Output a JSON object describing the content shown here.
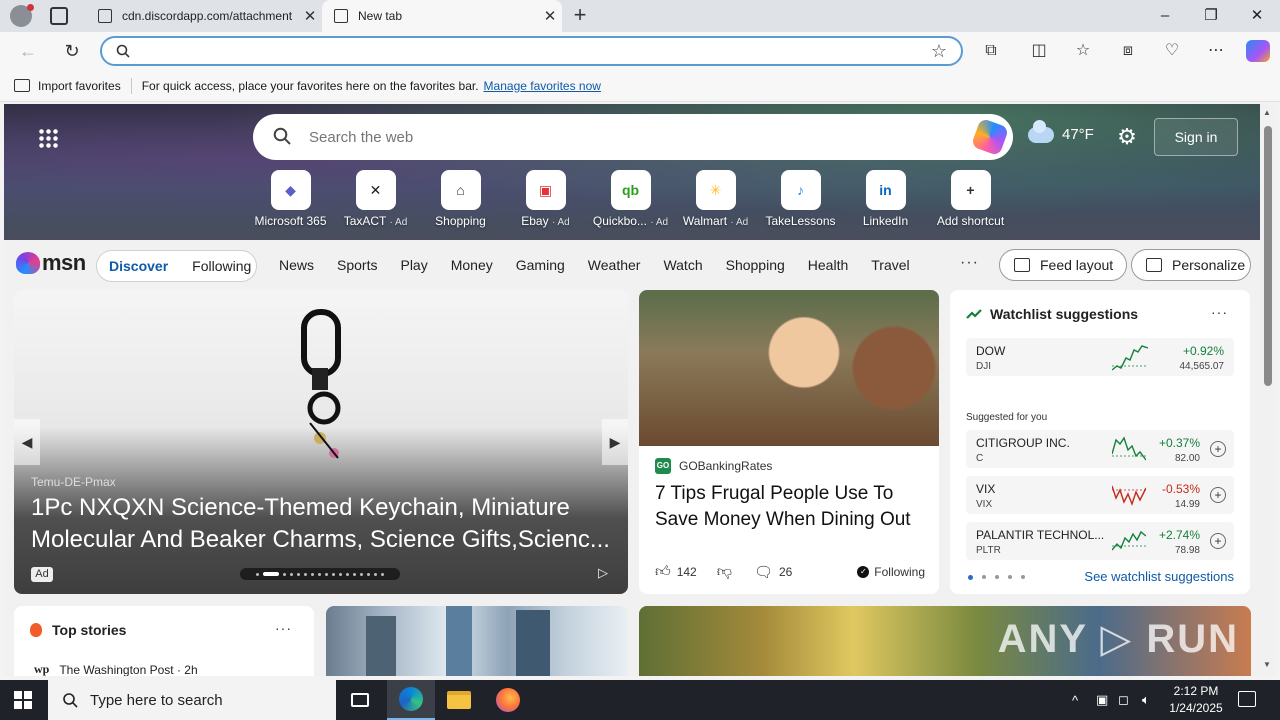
{
  "browser": {
    "tabs": [
      {
        "label": "cdn.discordapp.com/attachment",
        "active": false
      },
      {
        "label": "New tab",
        "active": true
      }
    ],
    "address": {
      "value": "",
      "placeholder": ""
    },
    "window_controls": {
      "minimize": "–",
      "restore": "❐",
      "close": "✕"
    },
    "favbar": {
      "import_label": "Import favorites",
      "hint": "For quick access, place your favorites here on the favorites bar.",
      "manage_link": "Manage favorites now"
    }
  },
  "hero": {
    "search_placeholder": "Search the web",
    "weather": "47°F",
    "signin": "Sign in",
    "shortcuts": [
      {
        "label": "Microsoft 365",
        "ad": "",
        "icon": "microsoft365-icon",
        "glyph": "◆",
        "color": "#5b5fc7"
      },
      {
        "label": "TaxACT",
        "ad": "· Ad",
        "icon": "taxact-icon",
        "glyph": "✕",
        "color": "#1b1f2a"
      },
      {
        "label": "Shopping",
        "ad": "",
        "icon": "shopping-tag-icon",
        "glyph": "⌂",
        "color": "#333333"
      },
      {
        "label": "Ebay",
        "ad": "· Ad",
        "icon": "ebay-icon",
        "glyph": "▣",
        "color": "#e53238"
      },
      {
        "label": "Quickbo...",
        "ad": "· Ad",
        "icon": "quickbooks-icon",
        "glyph": "qb",
        "color": "#2ca01c"
      },
      {
        "label": "Walmart",
        "ad": "· Ad",
        "icon": "walmart-icon",
        "glyph": "✳",
        "color": "#ffc220"
      },
      {
        "label": "TakeLessons",
        "ad": "",
        "icon": "takelessons-icon",
        "glyph": "♪",
        "color": "#2d89ef"
      },
      {
        "label": "LinkedIn",
        "ad": "",
        "icon": "linkedin-icon",
        "glyph": "in",
        "color": "#0a66c2"
      },
      {
        "label": "Add shortcut",
        "ad": "",
        "icon": "plus-icon",
        "glyph": "+",
        "color": "#333333"
      }
    ]
  },
  "msn": {
    "logo": "msn",
    "toggle": {
      "active": "Discover",
      "other": "Following"
    },
    "nav": [
      "News",
      "Sports",
      "Play",
      "Money",
      "Gaming",
      "Weather",
      "Watch",
      "Shopping",
      "Health",
      "Travel"
    ],
    "more": "···",
    "feed_layout": "Feed layout",
    "personalize": "Personalize"
  },
  "carousel": {
    "source": "Temu-DE-Pmax",
    "title": "1Pc NXQXN Science-Themed Keychain, Miniature Molecular And Beaker Charms, Science Gifts,Scienc...",
    "ad_label": "Ad"
  },
  "article": {
    "source": "GOBankingRates",
    "source_logo": "GO",
    "title": "7 Tips Frugal People Use To Save Money When Dining Out",
    "likes": "142",
    "comments": "26",
    "following": "Following"
  },
  "watchlist": {
    "title": "Watchlist suggestions",
    "more": "···",
    "main": {
      "name": "DOW",
      "symbol": "DJI",
      "change": "+0.92%",
      "value": "44,565.07",
      "direction": "up"
    },
    "suggested_label": "Suggested for you",
    "suggestions": [
      {
        "name": "CITIGROUP INC.",
        "symbol": "C",
        "change": "+0.37%",
        "value": "82.00",
        "direction": "up"
      },
      {
        "name": "VIX",
        "symbol": "VIX",
        "change": "-0.53%",
        "value": "14.99",
        "direction": "down"
      },
      {
        "name": "PALANTIR TECHNOL...",
        "symbol": "PLTR",
        "change": "+2.74%",
        "value": "78.98",
        "direction": "up"
      }
    ],
    "see_more": "See watchlist suggestions"
  },
  "top_stories": {
    "title": "Top stories",
    "more": "···",
    "source_logo": "wp",
    "source": "The Washington Post · 2h"
  },
  "watermark": "ANY ▷ RUN",
  "taskbar": {
    "search_placeholder": "Type here to search",
    "time": "2:12 PM",
    "date": "1/24/2025"
  }
}
